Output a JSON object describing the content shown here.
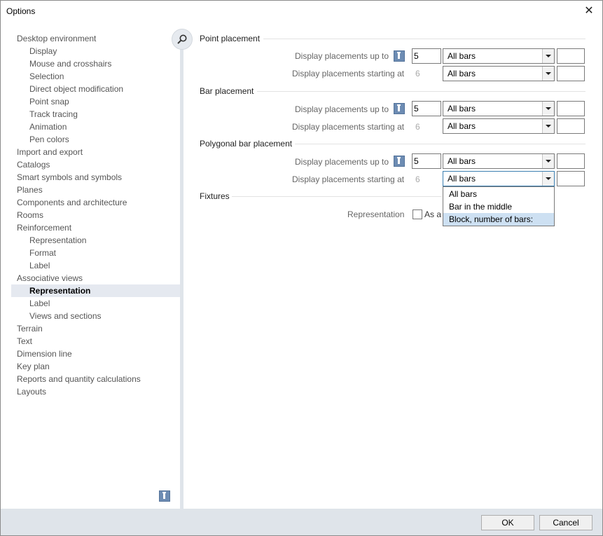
{
  "window": {
    "title": "Options",
    "close_glyph": "✕"
  },
  "sidebar": {
    "items": [
      {
        "label": "Desktop environment",
        "level": 0
      },
      {
        "label": "Display",
        "level": 1
      },
      {
        "label": "Mouse and crosshairs",
        "level": 1
      },
      {
        "label": "Selection",
        "level": 1
      },
      {
        "label": "Direct object modification",
        "level": 1
      },
      {
        "label": "Point snap",
        "level": 1
      },
      {
        "label": "Track tracing",
        "level": 1
      },
      {
        "label": "Animation",
        "level": 1
      },
      {
        "label": "Pen colors",
        "level": 1
      },
      {
        "label": "Import and export",
        "level": 0
      },
      {
        "label": "Catalogs",
        "level": 0
      },
      {
        "label": "Smart symbols and symbols",
        "level": 0
      },
      {
        "label": "Planes",
        "level": 0
      },
      {
        "label": "Components and architecture",
        "level": 0
      },
      {
        "label": "Rooms",
        "level": 0
      },
      {
        "label": "Reinforcement",
        "level": 0
      },
      {
        "label": "Representation",
        "level": 1
      },
      {
        "label": "Format",
        "level": 1
      },
      {
        "label": "Label",
        "level": 1
      },
      {
        "label": "Associative views",
        "level": 0
      },
      {
        "label": "Representation",
        "level": 1,
        "selected": true
      },
      {
        "label": "Label",
        "level": 1
      },
      {
        "label": "Views and sections",
        "level": 1
      },
      {
        "label": "Terrain",
        "level": 0
      },
      {
        "label": "Text",
        "level": 0
      },
      {
        "label": "Dimension line",
        "level": 0
      },
      {
        "label": "Key plan",
        "level": 0
      },
      {
        "label": "Reports and quantity calculations",
        "level": 0
      },
      {
        "label": "Layouts",
        "level": 0
      }
    ]
  },
  "sections": {
    "point": {
      "title": "Point placement",
      "up_to_label": "Display placements up to",
      "up_to_value": "5",
      "up_to_combo": "All bars",
      "starting_label": "Display placements starting at",
      "starting_value": "6",
      "starting_combo": "All bars"
    },
    "bar": {
      "title": "Bar placement",
      "up_to_label": "Display placements up to",
      "up_to_value": "5",
      "up_to_combo": "All bars",
      "starting_label": "Display placements starting at",
      "starting_value": "6",
      "starting_combo": "All bars"
    },
    "polygonal": {
      "title": "Polygonal bar placement",
      "up_to_label": "Display placements up to",
      "up_to_value": "5",
      "up_to_combo": "All bars",
      "starting_label": "Display placements starting at",
      "starting_value": "6",
      "starting_combo": "All bars"
    },
    "fixtures": {
      "title": "Fixtures",
      "representation_label": "Representation",
      "checkbox_label": "As a"
    }
  },
  "dropdown": {
    "options": [
      "All bars",
      "Bar in the middle",
      "Block, number of bars:"
    ],
    "highlighted_index": 2
  },
  "buttons": {
    "ok": "OK",
    "cancel": "Cancel"
  },
  "icons": {
    "search": "magnifier-icon",
    "info": "info-icon",
    "close": "close-icon"
  }
}
